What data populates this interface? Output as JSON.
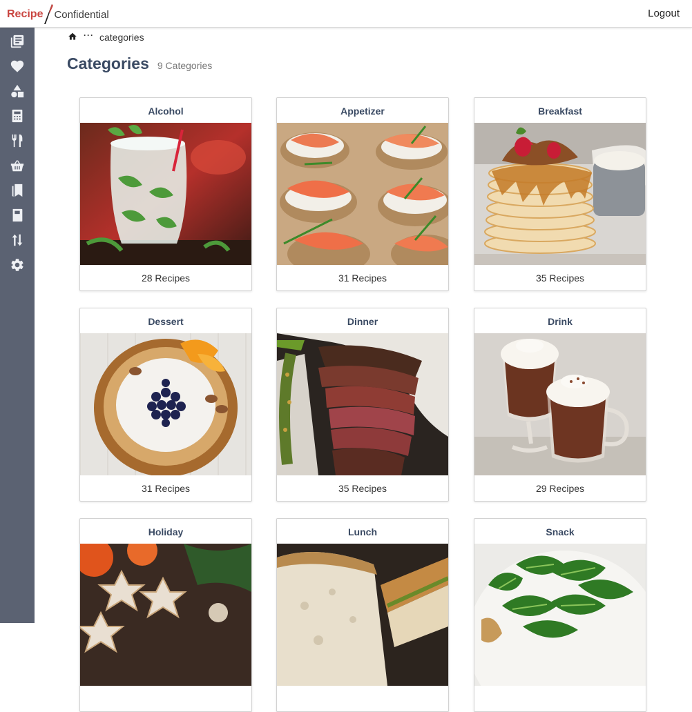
{
  "header": {
    "logo_primary": "Recipe",
    "logo_secondary": "Confidential",
    "logout_label": "Logout"
  },
  "sidebar": {
    "icons": [
      "library-icon",
      "heart-icon",
      "shapes-icon",
      "calculator-icon",
      "utensils-icon",
      "basket-icon",
      "bookmarks-icon",
      "book-icon",
      "sort-icon",
      "gear-icon"
    ]
  },
  "breadcrumb": {
    "home_icon": "home-icon",
    "ellipsis": "···",
    "current": "categories"
  },
  "page": {
    "title": "Categories",
    "count_label": "9 Categories"
  },
  "categories": [
    {
      "name": "Alcohol",
      "recipes": "28 Recipes",
      "image": "mojito-photo"
    },
    {
      "name": "Appetizer",
      "recipes": "31 Recipes",
      "image": "salmon-canape-photo"
    },
    {
      "name": "Breakfast",
      "recipes": "35 Recipes",
      "image": "pancake-stack-photo"
    },
    {
      "name": "Dessert",
      "recipes": "31 Recipes",
      "image": "blueberry-tart-photo"
    },
    {
      "name": "Dinner",
      "recipes": "35 Recipes",
      "image": "sliced-steak-photo"
    },
    {
      "name": "Drink",
      "recipes": "29 Recipes",
      "image": "hot-chocolate-photo"
    },
    {
      "name": "Holiday",
      "recipes": "",
      "image": "star-cookies-photo"
    },
    {
      "name": "Lunch",
      "recipes": "",
      "image": "sandwich-photo"
    },
    {
      "name": "Snack",
      "recipes": "",
      "image": "spinach-salad-photo"
    }
  ],
  "colors": {
    "brand_red": "#c9443f",
    "sidebar_bg": "#5b6272",
    "heading": "#3a4a63"
  }
}
